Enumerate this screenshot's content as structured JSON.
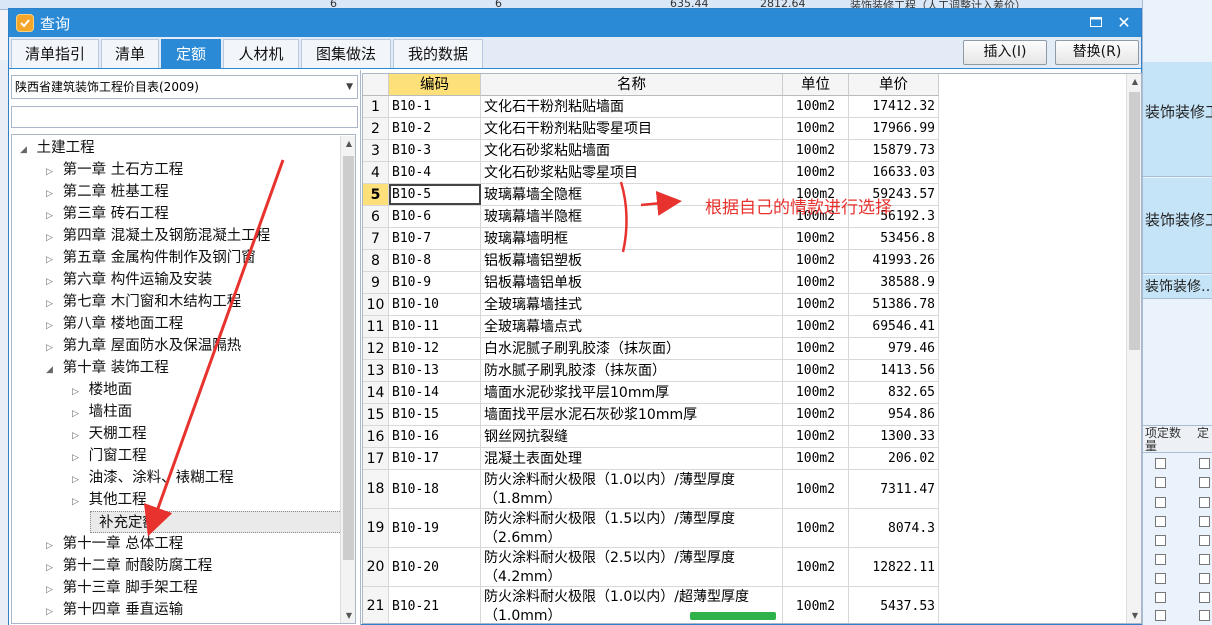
{
  "background": {
    "top_strip": [
      "6",
      "6",
      "635.44",
      "2812.64",
      "装饰装修工程（人工调整计入差价）"
    ],
    "right_cells": [
      "装饰装修工",
      "装饰装修工",
      "装饰装修…"
    ],
    "right_header": [
      "项定数量",
      "定"
    ]
  },
  "window": {
    "title": "查询",
    "maximize_icon": "maximize-icon",
    "close_glyph": "✕"
  },
  "tabs": [
    {
      "label": "清单指引",
      "active": false
    },
    {
      "label": "清单",
      "active": false
    },
    {
      "label": "定额",
      "active": true
    },
    {
      "label": "人材机",
      "active": false
    },
    {
      "label": "图集做法",
      "active": false
    },
    {
      "label": "我的数据",
      "active": false
    }
  ],
  "actions": {
    "insert_label": "插入(I)",
    "replace_label": "替换(R)"
  },
  "library": {
    "selected": "陕西省建筑装饰工程价目表(2009)",
    "search_value": ""
  },
  "tree": [
    {
      "label": "土建工程",
      "level": 0,
      "state": "expanded"
    },
    {
      "label": "第一章 土石方工程",
      "level": 1,
      "state": "collapsed"
    },
    {
      "label": "第二章 桩基工程",
      "level": 1,
      "state": "collapsed"
    },
    {
      "label": "第三章 砖石工程",
      "level": 1,
      "state": "collapsed"
    },
    {
      "label": "第四章 混凝土及钢筋混凝土工程",
      "level": 1,
      "state": "collapsed"
    },
    {
      "label": "第五章 金属构件制作及钢门窗",
      "level": 1,
      "state": "collapsed"
    },
    {
      "label": "第六章 构件运输及安装",
      "level": 1,
      "state": "collapsed"
    },
    {
      "label": "第七章 木门窗和木结构工程",
      "level": 1,
      "state": "collapsed"
    },
    {
      "label": "第八章 楼地面工程",
      "level": 1,
      "state": "collapsed"
    },
    {
      "label": "第九章 屋面防水及保温隔热",
      "level": 1,
      "state": "collapsed"
    },
    {
      "label": "第十章 装饰工程",
      "level": 1,
      "state": "expanded"
    },
    {
      "label": "楼地面",
      "level": 2,
      "state": "collapsed"
    },
    {
      "label": "墙柱面",
      "level": 2,
      "state": "collapsed"
    },
    {
      "label": "天棚工程",
      "level": 2,
      "state": "collapsed"
    },
    {
      "label": "门窗工程",
      "level": 2,
      "state": "collapsed"
    },
    {
      "label": "油漆、涂料、裱糊工程",
      "level": 2,
      "state": "collapsed"
    },
    {
      "label": "其他工程",
      "level": 2,
      "state": "collapsed"
    },
    {
      "label": "补充定额",
      "level": 2,
      "state": "leaf",
      "selected": true
    },
    {
      "label": "第十一章 总体工程",
      "level": 1,
      "state": "collapsed"
    },
    {
      "label": "第十二章 耐酸防腐工程",
      "level": 1,
      "state": "collapsed"
    },
    {
      "label": "第十三章 脚手架工程",
      "level": 1,
      "state": "collapsed"
    },
    {
      "label": "第十四章 垂直运输",
      "level": 1,
      "state": "collapsed"
    }
  ],
  "table": {
    "headers": {
      "code": "编码",
      "name": "名称",
      "unit": "单位",
      "price": "单价"
    },
    "current_row": 5,
    "rows": [
      {
        "no": "1",
        "code": "B10-1",
        "name": "文化石干粉剂粘贴墙面",
        "unit": "100m2",
        "price": "17412.32"
      },
      {
        "no": "2",
        "code": "B10-2",
        "name": "文化石干粉剂粘贴零星项目",
        "unit": "100m2",
        "price": "17966.99"
      },
      {
        "no": "3",
        "code": "B10-3",
        "name": "文化石砂浆粘贴墙面",
        "unit": "100m2",
        "price": "15879.73"
      },
      {
        "no": "4",
        "code": "B10-4",
        "name": "文化石砂浆粘贴零星项目",
        "unit": "100m2",
        "price": "16633.03"
      },
      {
        "no": "5",
        "code": "B10-5",
        "name": "玻璃幕墙全隐框",
        "unit": "100m2",
        "price": "59243.57"
      },
      {
        "no": "6",
        "code": "B10-6",
        "name": "玻璃幕墙半隐框",
        "unit": "100m2",
        "price": "56192.3"
      },
      {
        "no": "7",
        "code": "B10-7",
        "name": "玻璃幕墙明框",
        "unit": "100m2",
        "price": "53456.8"
      },
      {
        "no": "8",
        "code": "B10-8",
        "name": "铝板幕墙铝塑板",
        "unit": "100m2",
        "price": "41993.26"
      },
      {
        "no": "9",
        "code": "B10-9",
        "name": "铝板幕墙铝单板",
        "unit": "100m2",
        "price": "38588.9"
      },
      {
        "no": "10",
        "code": "B10-10",
        "name": "全玻璃幕墙挂式",
        "unit": "100m2",
        "price": "51386.78"
      },
      {
        "no": "11",
        "code": "B10-11",
        "name": "全玻璃幕墙点式",
        "unit": "100m2",
        "price": "69546.41"
      },
      {
        "no": "12",
        "code": "B10-12",
        "name": "白水泥腻子刷乳胶漆（抹灰面）",
        "unit": "100m2",
        "price": "979.46"
      },
      {
        "no": "13",
        "code": "B10-13",
        "name": "防水腻子刷乳胶漆（抹灰面）",
        "unit": "100m2",
        "price": "1413.56"
      },
      {
        "no": "14",
        "code": "B10-14",
        "name": "墙面水泥砂浆找平层10mm厚",
        "unit": "100m2",
        "price": "832.65"
      },
      {
        "no": "15",
        "code": "B10-15",
        "name": "墙面找平层水泥石灰砂浆10mm厚",
        "unit": "100m2",
        "price": "954.86"
      },
      {
        "no": "16",
        "code": "B10-16",
        "name": "钢丝网抗裂缝",
        "unit": "100m2",
        "price": "1300.33"
      },
      {
        "no": "17",
        "code": "B10-17",
        "name": "混凝土表面处理",
        "unit": "100m2",
        "price": "206.02"
      },
      {
        "no": "18",
        "code": "B10-18",
        "name": "防火涂料耐火极限（1.0以内）/薄型厚度（1.8mm）",
        "unit": "100m2",
        "price": "7311.47"
      },
      {
        "no": "19",
        "code": "B10-19",
        "name": "防火涂料耐火极限（1.5以内）/薄型厚度（2.6mm）",
        "unit": "100m2",
        "price": "8074.3"
      },
      {
        "no": "20",
        "code": "B10-20",
        "name": "防火涂料耐火极限（2.5以内）/薄型厚度（4.2mm）",
        "unit": "100m2",
        "price": "12822.11"
      },
      {
        "no": "21",
        "code": "B10-21",
        "name": "防火涂料耐火极限（1.0以内）/超薄型厚度（1.0mm）",
        "unit": "100m2",
        "price": "5437.53"
      }
    ]
  },
  "annotation": {
    "text": "根据自己的情款进行选择",
    "color": "#e8322e"
  },
  "colors": {
    "titlebar": "#2b8ad6",
    "active_tab": "#2b8ad6",
    "code_header": "#fde07a"
  }
}
